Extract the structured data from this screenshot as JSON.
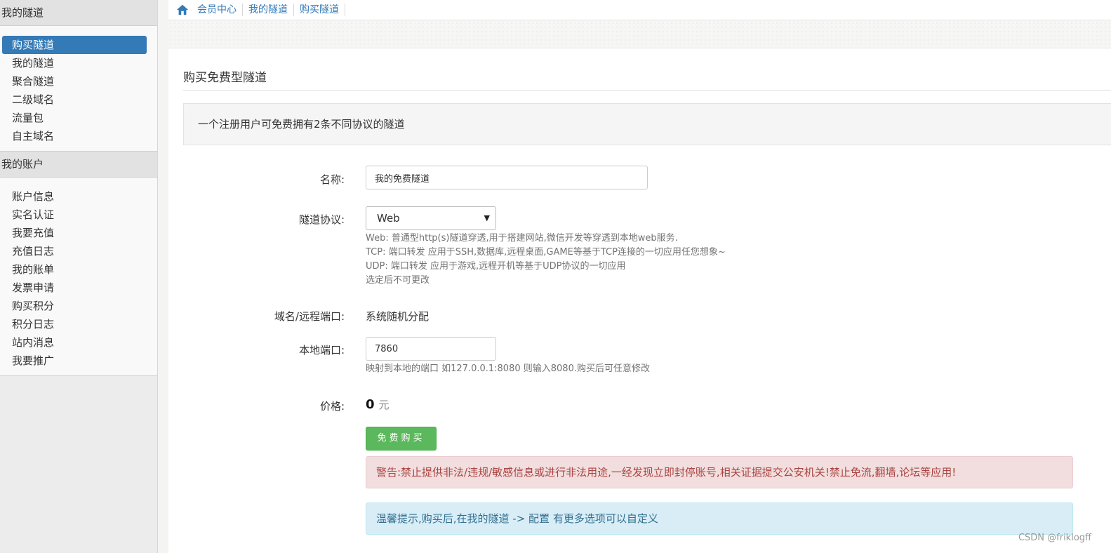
{
  "sidebar": {
    "section1": {
      "title": "我的隧道",
      "items": [
        "购买隧道",
        "我的隧道",
        "聚合隧道",
        "二级域名",
        "流量包",
        "自主域名"
      ]
    },
    "section2": {
      "title": "我的账户",
      "items": [
        "账户信息",
        "实名认证",
        "我要充值",
        "充值日志",
        "我的账单",
        "发票申请",
        "购买积分",
        "积分日志",
        "站内消息",
        "我要推广"
      ]
    }
  },
  "breadcrumb": [
    "会员中心",
    "我的隧道",
    "购买隧道"
  ],
  "page": {
    "title": "购买免费型隧道",
    "notice": "一个注册用户可免费拥有2条不同协议的隧道"
  },
  "form": {
    "name_label": "名称:",
    "name_value": "我的免费隧道",
    "protocol_label": "隧道协议:",
    "protocol_value": "Web",
    "protocol_help": [
      "Web: 普通型http(s)隧道穿透,用于搭建网站,微信开发等穿透到本地web服务.",
      "TCP: 端口转发 应用于SSH,数据库,远程桌面,GAME等基于TCP连接的一切应用任您想象~",
      "UDP: 端口转发 应用于游戏,远程开机等基于UDP协议的一切应用",
      "选定后不可更改"
    ],
    "domain_label": "域名/远程端口:",
    "domain_value": "系统随机分配",
    "local_port_label": "本地端口:",
    "local_port_value": "7860",
    "local_port_help": "映射到本地的端口 如127.0.0.1:8080 则输入8080.购买后可任意修改",
    "price_label": "价格:",
    "price_value": "0",
    "price_unit": "元",
    "buy_button": "免费购买"
  },
  "alerts": {
    "warning": "警告:禁止提供非法/违规/敏感信息或进行非法用途,一经发现立即封停账号,相关证据提交公安机关!禁止免流,翻墙,论坛等应用!",
    "info": "温馨提示,购买后,在我的隧道 -> 配置 有更多选项可以自定义"
  },
  "watermark": "CSDN @friklogff",
  "colors": {
    "primary": "#337ab7",
    "success": "#5cb85c",
    "danger_bg": "#f2dede",
    "info_bg": "#d9edf7"
  }
}
